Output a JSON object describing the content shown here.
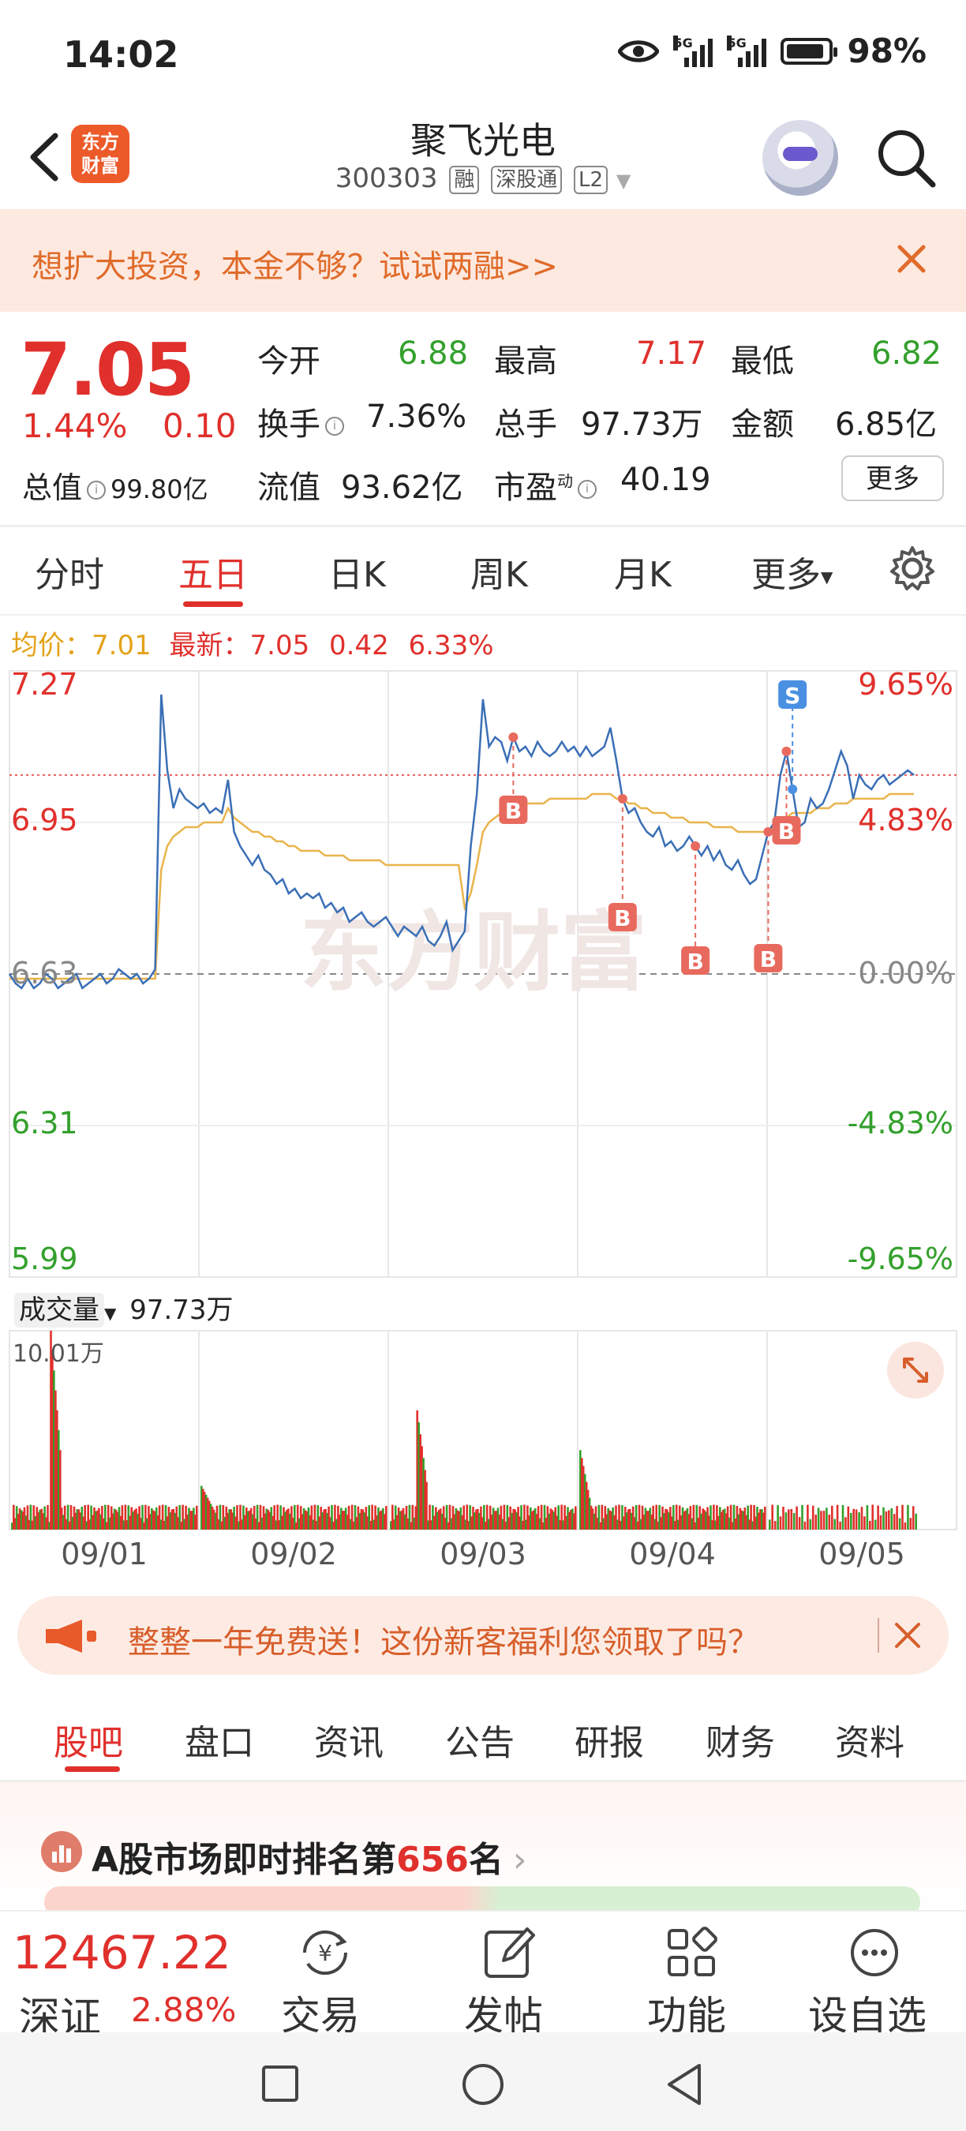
{
  "status_bar": {
    "time": "14:02",
    "battery": "98%",
    "net1": "5G",
    "net2": "5G"
  },
  "header": {
    "logo_line1": "东方",
    "logo_line2": "财富",
    "title": "聚飞光电",
    "code": "300303",
    "tags": [
      "融",
      "深股通",
      "L2"
    ]
  },
  "promo": {
    "text": "想扩大投资，本金不够？试试两融>>"
  },
  "quote": {
    "price": "7.05",
    "change_pct": "1.44%",
    "change": "0.10",
    "market_cap_label": "总值",
    "market_cap": "99.80亿",
    "stats": [
      {
        "label": "今开",
        "value": "6.88"
      },
      {
        "label": "最高",
        "value": "7.17"
      },
      {
        "label": "最低",
        "value": "6.82"
      },
      {
        "label": "换手",
        "value": "7.36%"
      },
      {
        "label": "总手",
        "value": "97.73万"
      },
      {
        "label": "金额",
        "value": "6.85亿"
      },
      {
        "label": "流值",
        "value": "93.62亿"
      },
      {
        "label": "市盈",
        "value": "40.19",
        "sup": "动"
      }
    ],
    "more": "更多"
  },
  "chart_tabs": [
    "分时",
    "五日",
    "日K",
    "周K",
    "月K",
    "更多"
  ],
  "chart_tabs_active": 1,
  "avg_line": {
    "avg_label": "均价：",
    "avg": "7.01",
    "latest_label": "最新：",
    "latest": "7.05",
    "chg": "0.42",
    "pct": "6.33%"
  },
  "chart_data": {
    "type": "line",
    "x_labels": [
      "09/01",
      "09/02",
      "09/03",
      "09/04",
      "09/05"
    ],
    "price_axis": [
      "7.27",
      "6.95",
      "6.63",
      "6.31",
      "5.99"
    ],
    "pct_axis": [
      "9.65%",
      "4.83%",
      "0.00%",
      "-4.83%",
      "-9.65%"
    ],
    "ylim": [
      5.99,
      7.27
    ],
    "prev_close": 6.63,
    "series": [
      {
        "points": [
          6.63,
          6.61,
          6.6,
          6.62,
          6.6,
          6.61,
          6.63,
          6.62,
          6.6,
          6.61,
          6.62,
          6.63,
          6.6,
          6.61,
          6.62,
          6.63,
          6.61,
          6.62,
          6.64,
          6.63,
          6.62,
          6.63,
          6.61,
          6.62,
          6.64,
          7.22,
          7.06,
          6.98,
          7.02,
          7.0,
          6.99,
          6.98,
          6.99,
          6.97,
          6.98,
          6.97,
          7.04,
          6.93,
          6.9,
          6.88,
          6.86,
          6.88,
          6.85,
          6.84,
          6.82,
          6.83,
          6.8,
          6.81,
          6.79,
          6.8,
          6.79,
          6.8,
          6.77,
          6.78,
          6.76,
          6.77,
          6.74,
          6.75,
          6.76,
          6.74,
          6.73,
          6.74,
          6.75,
          6.73,
          6.71,
          6.73,
          6.72,
          6.71,
          6.73,
          6.7,
          6.69,
          6.71,
          6.74,
          6.68,
          6.7,
          6.72,
          6.9,
          7.01,
          7.21,
          7.11,
          7.13,
          7.12,
          7.08,
          7.13,
          7.1,
          7.11,
          7.09,
          7.12,
          7.1,
          7.09,
          7.1,
          7.12,
          7.1,
          7.11,
          7.09,
          7.11,
          7.09,
          7.1,
          7.11,
          7.15,
          7.08,
          7.0,
          6.97,
          6.98,
          6.95,
          6.93,
          6.92,
          6.94,
          6.9,
          6.91,
          6.89,
          6.9,
          6.92,
          6.9,
          6.88,
          6.9,
          6.87,
          6.89,
          6.86,
          6.85,
          6.87,
          6.84,
          6.82,
          6.83,
          6.88,
          6.93,
          6.95,
          7.05,
          7.1,
          7.02,
          6.94,
          6.95,
          7.0,
          6.98,
          6.99,
          7.02,
          7.06,
          7.1,
          7.07,
          7.0,
          7.05,
          7.03,
          7.02,
          7.04,
          7.05,
          7.03,
          7.04,
          7.05,
          7.06,
          7.05
        ]
      },
      {
        "name": "均价",
        "points": [
          6.62,
          6.62,
          6.62,
          6.62,
          6.62,
          6.62,
          6.62,
          6.62,
          6.62,
          6.62,
          6.62,
          6.62,
          6.62,
          6.62,
          6.62,
          6.62,
          6.62,
          6.62,
          6.62,
          6.62,
          6.62,
          6.62,
          6.62,
          6.62,
          6.62,
          6.85,
          6.9,
          6.92,
          6.93,
          6.94,
          6.94,
          6.94,
          6.95,
          6.95,
          6.95,
          6.95,
          6.98,
          6.96,
          6.95,
          6.94,
          6.93,
          6.93,
          6.92,
          6.92,
          6.91,
          6.91,
          6.9,
          6.9,
          6.89,
          6.89,
          6.89,
          6.89,
          6.88,
          6.88,
          6.88,
          6.88,
          6.87,
          6.87,
          6.87,
          6.87,
          6.87,
          6.87,
          6.86,
          6.86,
          6.86,
          6.86,
          6.86,
          6.86,
          6.86,
          6.86,
          6.86,
          6.86,
          6.86,
          6.86,
          6.86,
          6.77,
          6.8,
          6.86,
          6.93,
          6.95,
          6.96,
          6.97,
          6.97,
          6.98,
          6.98,
          6.99,
          6.99,
          6.99,
          6.99,
          7.0,
          7.0,
          7.0,
          7.0,
          7.0,
          7.0,
          7.0,
          7.01,
          7.01,
          7.01,
          7.01,
          7.0,
          7.0,
          6.99,
          6.99,
          6.98,
          6.98,
          6.97,
          6.97,
          6.97,
          6.96,
          6.96,
          6.96,
          6.95,
          6.95,
          6.95,
          6.95,
          6.94,
          6.94,
          6.94,
          6.94,
          6.93,
          6.93,
          6.93,
          6.93,
          6.93,
          6.93,
          6.94,
          6.95,
          6.96,
          6.97,
          6.97,
          6.97,
          6.97,
          6.98,
          6.98,
          6.98,
          6.99,
          6.99,
          6.99,
          7.0,
          7.0,
          7.0,
          7.0,
          7.0,
          7.0,
          7.01,
          7.01,
          7.01,
          7.01,
          7.01
        ]
      }
    ],
    "markers": [
      "B",
      "B",
      "B",
      "B",
      "B",
      "S"
    ],
    "volume_label": "成交量",
    "volume_total": "97.73万",
    "volume_max": "10.01万",
    "volume_max_value": 10.01
  },
  "ad": {
    "text": "整整一年免费送！这份新客福利您领取了吗？"
  },
  "bottom_tabs": [
    "股吧",
    "盘口",
    "资讯",
    "公告",
    "研报",
    "财务",
    "资料"
  ],
  "rank": {
    "prefix": "A股市场即时排名第",
    "rank": "656",
    "suffix": "名"
  },
  "toolbar": {
    "index_value": "12467.22",
    "index_name": "深证",
    "index_pct": "2.88%",
    "items": [
      {
        "label": "交易",
        "icon": "trade-icon"
      },
      {
        "label": "发帖",
        "icon": "post-icon"
      },
      {
        "label": "功能",
        "icon": "functions-icon"
      },
      {
        "label": "设自选",
        "icon": "add-watchlist-icon"
      }
    ]
  }
}
